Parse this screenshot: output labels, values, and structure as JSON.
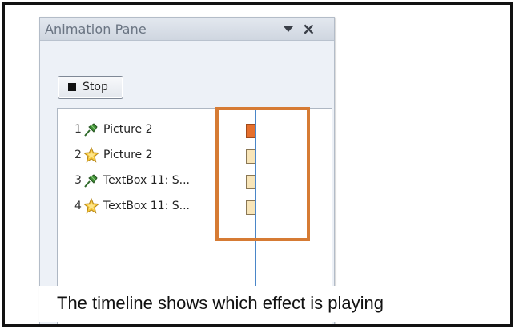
{
  "pane": {
    "title": "Animation Pane",
    "stop_label": "Stop"
  },
  "animations": [
    {
      "number": "1",
      "label": "Picture 2",
      "effect_icon": "entrance-pin-icon",
      "playing": true
    },
    {
      "number": "2",
      "label": "Picture 2",
      "effect_icon": "emphasis-star-icon",
      "playing": false
    },
    {
      "number": "3",
      "label": "TextBox 11: S...",
      "effect_icon": "entrance-pin-icon",
      "playing": false
    },
    {
      "number": "4",
      "label": "TextBox 11: S...",
      "effect_icon": "emphasis-star-icon",
      "playing": false
    }
  ],
  "caption": "The timeline shows which effect is playing",
  "colors": {
    "highlight": "#d67b34",
    "timeline_active": "#e56f2d",
    "timeline_idle": "#f8e5b8",
    "timeline_line": "#4a86c8"
  }
}
